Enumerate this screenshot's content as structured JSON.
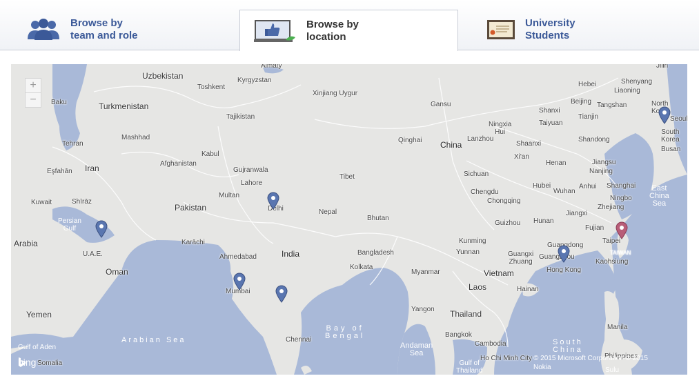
{
  "tabs": [
    {
      "label": "Browse by\nteam and role",
      "icon": "team-people-icon"
    },
    {
      "label": "Browse by\nlocation",
      "icon": "location-thumbs-up-laptop-icon"
    },
    {
      "label": "University\nStudents",
      "icon": "diploma-certificate-icon"
    }
  ],
  "map": {
    "provider_name": "bing",
    "copyright": "© 2015 Microsoft Corporation  © 2015 Nokia",
    "zoom_in_label": "+",
    "zoom_out_label": "−",
    "pin_color": "#5a76b0",
    "pin_active_color": "#b85d78",
    "labels": {
      "uzbekistan": "Uzbekistan",
      "toshkent": "Toshkent",
      "almaty": "Almaty",
      "kyrgyzstan": "Kyrgyzstan",
      "xinjiang": "Xinjiang Uygur",
      "gansu": "Gansu",
      "hebei": "Hebei",
      "beijing": "Beijing",
      "tianjin": "Tianjin",
      "jilin": "Jilin",
      "shenyang": "Shenyang",
      "liaoning": "Liaoning",
      "tangshan": "Tangshan",
      "north_korea": "North\nKorea",
      "seoul": "Seoul",
      "south_korea": "South\nKorea",
      "busan": "Busan",
      "baku": "Baku",
      "turkmenistan": "Turkmenistan",
      "tajikistan": "Tajikistan",
      "mashhad": "Mashhad",
      "tehran": "Tehran",
      "kabul": "Kabul",
      "afghanistan": "Afghanistan",
      "iran": "Iran",
      "esfahan": "Eşfahān",
      "shiraz": "Shīrāz",
      "kuwait": "Kuwait",
      "gujranwala": "Gujranwala",
      "lahore": "Lahore",
      "multan": "Multan",
      "pakistan": "Pakistan",
      "delhi": "Delhi",
      "nepal": "Nepal",
      "tibet": "Tibet",
      "qinghai": "Qinghai",
      "china": "China",
      "lanzhou": "Lanzhou",
      "ningxia": "Ningxia\nHui",
      "shanxi": "Shanxi",
      "taiyuan": "Taiyuan",
      "shaanxi": "Shaanxi",
      "xian": "Xi'an",
      "henan": "Henan",
      "shandong": "Shandong",
      "jiangsu": "Jiangsu",
      "nanjing": "Nanjing",
      "anhui": "Anhui",
      "shanghai": "Shanghai",
      "ningbo": "Ningbo",
      "zhejiang": "Zhejiang",
      "hubei": "Hubei",
      "wuhan": "Wuhan",
      "sichuan": "Sichuan",
      "chengdu": "Chengdu",
      "chongqing": "Chongqing",
      "guizhou": "Guizhou",
      "hunan": "Hunan",
      "jiangxi": "Jiangxi",
      "fujian": "Fujian",
      "taipei": "Taipei",
      "taiwan": "TAIWAN",
      "kaohsiung": "Kaohsiung",
      "east_china_sea": "East\nChina\nSea",
      "persian_gulf": "Persian\nGulf",
      "uae": "U.A.E.",
      "arabia": "Arabia",
      "karachi": "Karāchi",
      "oman": "Oman",
      "ahmedabad": "Ahmedabad",
      "india": "India",
      "mumbai": "Mumbai",
      "bhutan": "Bhutan",
      "bangladesh": "Bangladesh",
      "kolkata": "Kolkata",
      "myanmar": "Myanmar",
      "kunming": "Kunming",
      "yunnan": "Yunnan",
      "guangxi": "Guangxi\nZhuang",
      "guangdong": "Guangdong",
      "guangzhou": "Guangzhou",
      "hong_kong": "Hong Kong",
      "vietnam": "Vietnam",
      "laos": "Laos",
      "hainan": "Hainan",
      "yangon": "Yangon",
      "thailand": "Thailand",
      "bangkok": "Bangkok",
      "cambodia": "Cambodia",
      "ho_chi_minh": "Ho Chi Minh City",
      "gulf_thailand": "Gulf of\nThailand",
      "bay_of_bengal": "Bay of\nBengal",
      "andaman_sea": "Andaman\nSea",
      "south_china_sea": "South\nChina",
      "philippines": "Philippines",
      "manila": "Manila",
      "sulu": "Sulu",
      "chennai": "Chennai",
      "yemen": "Yemen",
      "gulf_aden": "Gulf of Aden",
      "somalia": "Somalia",
      "arabian_sea": "Arabian Sea"
    }
  }
}
